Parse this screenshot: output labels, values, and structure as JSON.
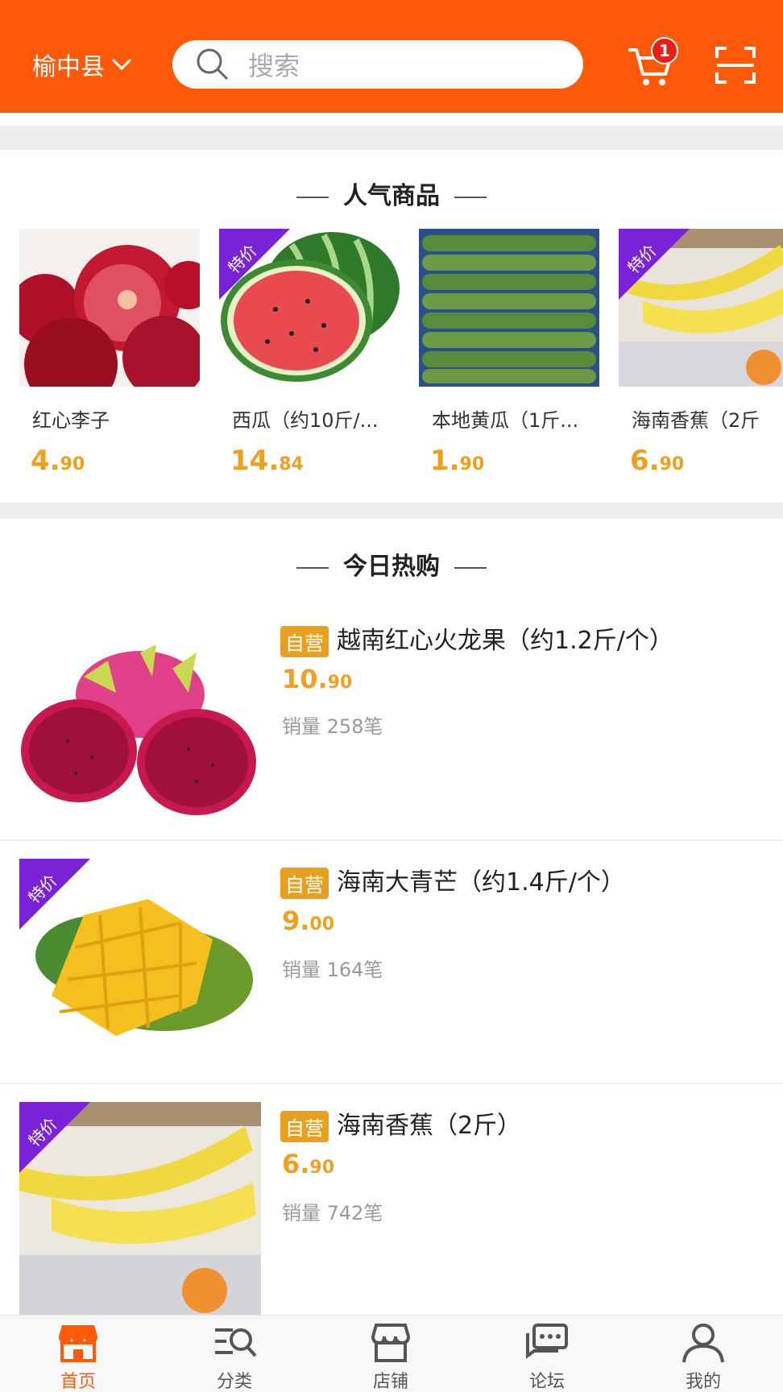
{
  "header": {
    "location": "榆中县",
    "search_placeholder": "搜索",
    "cart_count": "1"
  },
  "popular": {
    "title": "人气商品",
    "items": [
      {
        "name": "红心李子",
        "price_int": "4.",
        "price_dec": "90",
        "special": false
      },
      {
        "name": "西瓜（约10斤/...",
        "price_int": "14.",
        "price_dec": "84",
        "special": true
      },
      {
        "name": "本地黄瓜（1斤...",
        "price_int": "1.",
        "price_dec": "90",
        "special": false
      },
      {
        "name": "海南香蕉（2斤",
        "price_int": "6.",
        "price_dec": "90",
        "special": true
      }
    ]
  },
  "hot": {
    "title": "今日热购",
    "self_label": "自营",
    "special_label": "特价",
    "items": [
      {
        "name": "越南红心火龙果（约1.2斤/个）",
        "price_int": "10.",
        "price_dec": "90",
        "sales": "销量 258笔"
      },
      {
        "name": "海南大青芒（约1.4斤/个）",
        "price_int": "9.",
        "price_dec": "00",
        "sales": "销量 164笔"
      },
      {
        "name": "海南香蕉（2斤）",
        "price_int": "6.",
        "price_dec": "90",
        "sales": "销量 742笔"
      }
    ]
  },
  "nav": [
    {
      "label": "首页",
      "icon": "store-icon",
      "active": true
    },
    {
      "label": "分类",
      "icon": "category-search-icon",
      "active": false
    },
    {
      "label": "店铺",
      "icon": "shop-icon",
      "active": false
    },
    {
      "label": "论坛",
      "icon": "chat-icon",
      "active": false
    },
    {
      "label": "我的",
      "icon": "user-icon",
      "active": false
    }
  ],
  "colors": {
    "brand": "#ff5a0a",
    "price": "#f0a020",
    "special": "#7a22d8"
  }
}
